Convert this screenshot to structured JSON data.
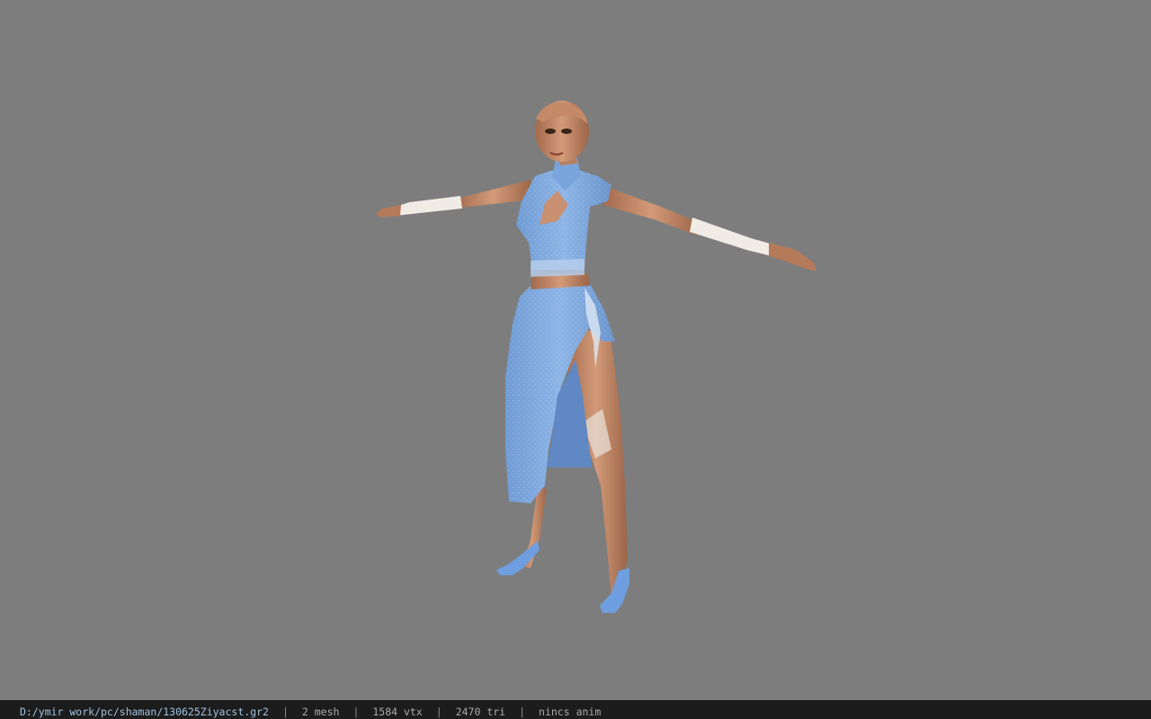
{
  "viewport": {
    "background_color": "#7d7d7d",
    "model": {
      "description_icon": "character-model-3d",
      "dress_color": "#7ea8de",
      "skin_color": "#c08a6a",
      "glove_color": "#f1ebe6"
    }
  },
  "status_bar": {
    "file_path": "D:/ymir work/pc/shaman/130625Ziyacst.gr2",
    "separator": "|",
    "mesh_count": "2 mesh",
    "vertex_count": "1584 vtx",
    "triangle_count": "2470 tri",
    "anim": "nincs anim"
  }
}
